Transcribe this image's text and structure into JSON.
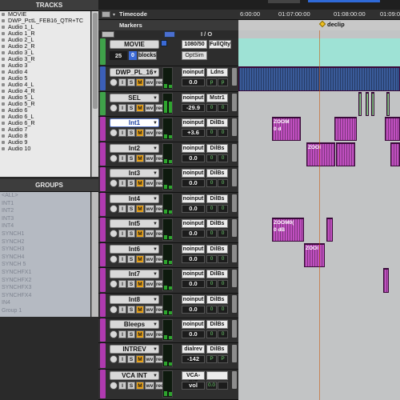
{
  "tracks_panel": {
    "title": "TRACKS",
    "items": [
      "MOVIE",
      "DWP_PctL_FEB16_QTR+TC",
      "Audio 1_L",
      "Audio 1_R",
      "Audio 2_L",
      "Audio 2_R",
      "Audio 3_L",
      "Audio 3_R",
      "Audio 3",
      "Audio 4",
      "Audio 5",
      "Audio 4_L",
      "Audio 4_R",
      "Audio 5_L",
      "Audio 5_R",
      "Audio 6",
      "Audio 6_L",
      "Audio 6_R",
      "Audio 7",
      "Audio 8",
      "Audio 9",
      "Audio 10"
    ]
  },
  "groups_panel": {
    "title": "GROUPS",
    "items": [
      "<ALL>",
      "INT1",
      "INT2",
      "INT3",
      "INT4",
      "SYNCH1",
      "SYNCH2",
      "SYNCH3",
      "SYNCH4",
      "SYNCH 5",
      "SYNCHFX1",
      "SYNCHFX2",
      "SYNCHFX3",
      "SYNCHFX4",
      "IN4",
      "Group 1"
    ]
  },
  "ruler": {
    "timecode_label": "Timecode",
    "times": [
      "6:00:00",
      "01:07:00:00",
      "01:08:00:00",
      "01:09:0"
    ],
    "markers_label": "Markers",
    "marker_name": "declip"
  },
  "header": {
    "io_label": "I / O"
  },
  "movie_track": {
    "name": "MOVIE",
    "fps": "25",
    "blocks_label": "blocks",
    "format": "1080/50",
    "quality": "FullQlty",
    "optsim": "OptSim"
  },
  "tracks": [
    {
      "name": "DWP_PL_16",
      "input": "noinput",
      "output": "Ldns",
      "volume": "0.0",
      "pan_l": "p",
      "pan_r": "p",
      "color": "#3b5fb8",
      "selected": false
    },
    {
      "name": "SEL",
      "input": "noinput",
      "output": "Mstr1",
      "volume": "-29.9",
      "pan_l": "0",
      "pan_r": "0",
      "color": "#3fa24a",
      "selected": false
    },
    {
      "name": "Int1",
      "input": "noinput",
      "output": "DilBs",
      "volume": "+3.6",
      "pan_l": "0",
      "pan_r": "0",
      "color": "#b03ab0",
      "selected": true
    },
    {
      "name": "Int2",
      "input": "noinput",
      "output": "DilBs",
      "volume": "0.0",
      "pan_l": "0",
      "pan_r": "0",
      "color": "#b03ab0",
      "selected": false
    },
    {
      "name": "Int3",
      "input": "noinput",
      "output": "DilBs",
      "volume": "0.0",
      "pan_l": "0",
      "pan_r": "0",
      "color": "#b03ab0",
      "selected": false
    },
    {
      "name": "Int4",
      "input": "noinput",
      "output": "DilBs",
      "volume": "0.0",
      "pan_l": "0",
      "pan_r": "0",
      "color": "#b03ab0",
      "selected": false
    },
    {
      "name": "Int5",
      "input": "noinput",
      "output": "DilBs",
      "volume": "0.0",
      "pan_l": "0",
      "pan_r": "0",
      "color": "#b03ab0",
      "selected": false
    },
    {
      "name": "Int6",
      "input": "noinput",
      "output": "DilBs",
      "volume": "0.0",
      "pan_l": "0",
      "pan_r": "0",
      "color": "#b03ab0",
      "selected": false
    },
    {
      "name": "Int7",
      "input": "noinput",
      "output": "DilBs",
      "volume": "0.0",
      "pan_l": "0",
      "pan_r": "0",
      "color": "#b03ab0",
      "selected": false
    },
    {
      "name": "Int8",
      "input": "noinput",
      "output": "DilBs",
      "volume": "0.0",
      "pan_l": "0",
      "pan_r": "0",
      "color": "#b03ab0",
      "selected": false
    },
    {
      "name": "Bleeps",
      "input": "noinput",
      "output": "DilBs",
      "volume": "0.0",
      "pan_l": "0",
      "pan_r": "0",
      "color": "#b03ab0",
      "selected": false
    },
    {
      "name": "INTREV",
      "input": "dialrev",
      "output": "DilBs",
      "volume": "-142",
      "pan_l": "P",
      "pan_r": "P",
      "color": "#b03ab0",
      "selected": false
    },
    {
      "name": "VCA INT",
      "input": "VCA-INT",
      "output": "",
      "volume": "vol",
      "pan_l": "0.0",
      "pan_r": "",
      "color": "#b03ab0",
      "selected": false
    }
  ],
  "track_buttons": {
    "rec": "",
    "input": "I",
    "solo": "S",
    "mute": "M",
    "view": "wv",
    "read": "red"
  },
  "clips": {
    "zoom1": "ZOOM",
    "zoom1_sub": "0 d",
    "zoom2": "ZOOI",
    "zoom5": "ZOOM0(",
    "zoom5_sub": "0 dB",
    "zoom6": "ZOOI"
  },
  "colors": {
    "purple_clip": "#c04fc0",
    "green_clip": "#8fd68f",
    "teal_track": "#9ee2d5",
    "audio_blue": "#3a5b9a"
  }
}
